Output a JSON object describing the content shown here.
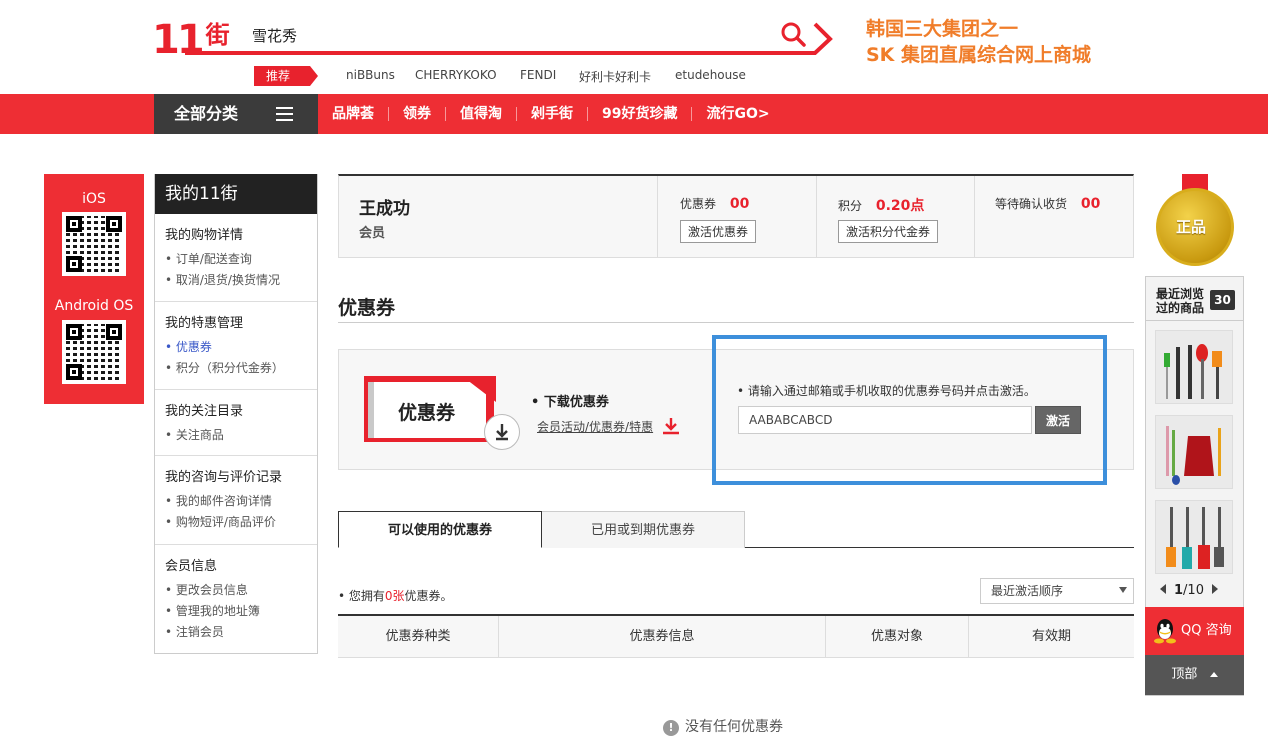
{
  "header": {
    "logo_num": "11",
    "logo_char": "街",
    "search_value": "雪花秀",
    "promo_line1": "韩国三大集团之一",
    "promo_line2": "SK 集团直属综合网上商城",
    "recommend_tag": "推荐",
    "keywords": [
      "niBBuns",
      "CHERRYKOKO",
      "FENDI",
      "好利卡好利卡",
      "etudehouse"
    ]
  },
  "nav": {
    "all_categories": "全部分类",
    "links": [
      "品牌荟",
      "领券",
      "值得淘",
      "剁手街",
      "99好货珍藏",
      "流行GO>"
    ]
  },
  "apps": {
    "ios_label": "iOS",
    "android_label": "Android OS"
  },
  "sidebar": {
    "title": "我的11街",
    "sections": [
      {
        "head": "我的购物详情",
        "items": [
          "• 订单/配送查询",
          "• 取消/退货/换货情况"
        ]
      },
      {
        "head": "我的特惠管理",
        "items": [
          "• 优惠券",
          "• 积分（积分代金券）"
        ]
      },
      {
        "head": "我的关注目录",
        "items": [
          "• 关注商品"
        ]
      },
      {
        "head": "我的咨询与评价记录",
        "items": [
          "• 我的邮件咨询详情",
          "• 购物短评/商品评价"
        ]
      },
      {
        "head": "会员信息",
        "items": [
          "• 更改会员信息",
          "• 管理我的地址簿",
          "• 注销会员"
        ]
      }
    ]
  },
  "user": {
    "name": "王成功",
    "grade": "会员",
    "coupon_label": "优惠券",
    "coupon_value": "00",
    "coupon_button": "激活优惠券",
    "points_label": "积分",
    "points_value": "0.20点",
    "points_button": "激活积分代金券",
    "pending_label": "等待确认收货",
    "pending_value": "00"
  },
  "coupon": {
    "section_title": "优惠券",
    "image_text": "优惠券",
    "download_title": "• 下载优惠券",
    "download_link": "会员活动/优惠券/特惠",
    "hint": "• 请输入通过邮箱或手机收取的优惠券号码并点击激活。",
    "input_value": "AABABCABCD",
    "activate_button": "激活",
    "tab_usable": "可以使用的优惠券",
    "tab_used": "已用或到期优惠券",
    "own_prefix": "• 您拥有",
    "own_count": "0张",
    "own_suffix": "优惠券。",
    "sort_value": "最近激活顺序",
    "columns": [
      "优惠券种类",
      "优惠券信息",
      "优惠对象",
      "有效期"
    ],
    "empty_text": "没有任何优惠券"
  },
  "rail": {
    "medal_text": "正品",
    "recent_title_1": "最近浏览",
    "recent_title_2": "过的商品",
    "recent_count": "30",
    "page_current": "1",
    "page_total": "/10",
    "qq_label": "QQ 咨询",
    "top_label": "顶部"
  },
  "colors": {
    "brand_red": "#ee2e34",
    "promo_orange": "#f07d2a",
    "highlight_blue": "#3d8fdb"
  }
}
